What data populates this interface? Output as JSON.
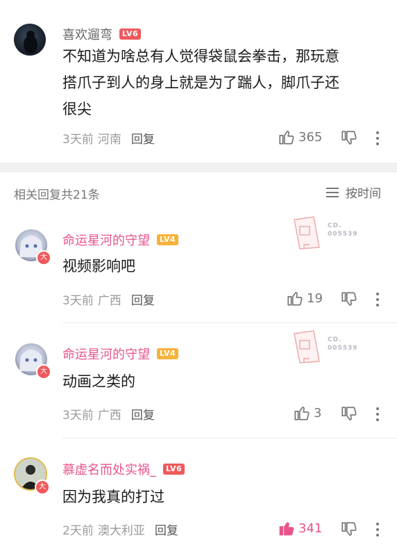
{
  "top_comment": {
    "username": "喜欢遛弯",
    "level": "LV6",
    "text_lines": [
      "不知道为啥总有人觉得袋鼠会拳击，那玩意",
      "搭爪子到人的身上就是为了踹人，脚爪子还",
      "很尖"
    ],
    "time": "3天前",
    "location": "河南",
    "reply_label": "回复",
    "likes": "365"
  },
  "replies_header": {
    "title": "相关回复共21条",
    "sort_label": "按时间"
  },
  "replies": [
    {
      "username": "命运星河的守望",
      "level": "LV4",
      "text": "视频影响吧",
      "time": "3天前",
      "location": "广西",
      "reply_label": "回复",
      "likes": "19",
      "badge_text": "CD.",
      "badge_number": "005539",
      "avatar_badge": "大"
    },
    {
      "username": "命运星河的守望",
      "level": "LV4",
      "text": "动画之类的",
      "time": "3天前",
      "location": "广西",
      "reply_label": "回复",
      "likes": "3",
      "badge_text": "CD.",
      "badge_number": "005539",
      "avatar_badge": "大"
    },
    {
      "username": "慕虚名而处实祸_",
      "level": "LV6",
      "text": "因为我真的打过",
      "time": "2天前",
      "location": "澳大利亚",
      "reply_label": "回复",
      "likes": "341",
      "avatar_badge": "大"
    }
  ],
  "icons": {
    "like": "thumbs-up-icon",
    "dislike": "thumbs-down-icon",
    "more": "more-vertical-icon",
    "sort": "sort-lines-icon"
  },
  "colors": {
    "accent_pink": "#e8548d",
    "level_red": "#f0595c",
    "level_orange": "#f7b23b"
  }
}
